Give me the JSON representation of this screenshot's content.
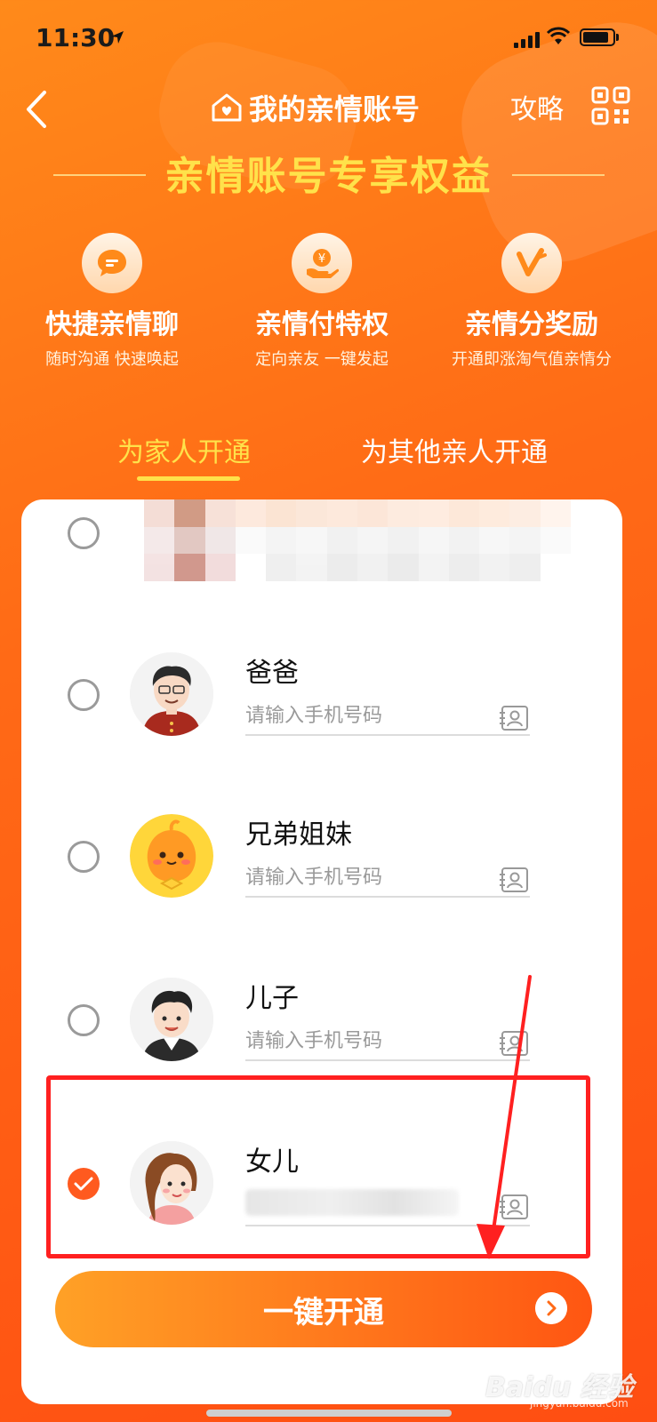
{
  "status_bar": {
    "time": "11:30"
  },
  "header": {
    "title": "我的亲情账号",
    "strategy_label": "攻略"
  },
  "benefits": {
    "title": "亲情账号专享权益",
    "items": [
      {
        "name": "快捷亲情聊",
        "desc": "随时沟通 快速唤起",
        "icon": "chat-bubble-icon"
      },
      {
        "name": "亲情付特权",
        "desc": "定向亲友 一键发起",
        "icon": "yuan-hand-icon"
      },
      {
        "name": "亲情分奖励",
        "desc": "开通即涨淘气值亲情分",
        "icon": "v-badge-icon"
      }
    ]
  },
  "tabs": [
    {
      "label": "为家人开通",
      "active": true
    },
    {
      "label": "为其他亲人开通",
      "active": false
    }
  ],
  "members": [
    {
      "name": "爸爸",
      "placeholder": "请输入手机号码",
      "selected": false
    },
    {
      "name": "兄弟姐妹",
      "placeholder": "请输入手机号码",
      "selected": false
    },
    {
      "name": "儿子",
      "placeholder": "请输入手机号码",
      "selected": false
    },
    {
      "name": "女儿",
      "placeholder": "",
      "selected": true
    }
  ],
  "action": {
    "open_label": "一键开通"
  },
  "watermark": {
    "brand": "Baidu 经验",
    "sub": "jingyan.baidu.com"
  },
  "colors": {
    "accent": "#ff5a1f",
    "highlight": "#ffe24a",
    "annotation": "#ff2020"
  }
}
